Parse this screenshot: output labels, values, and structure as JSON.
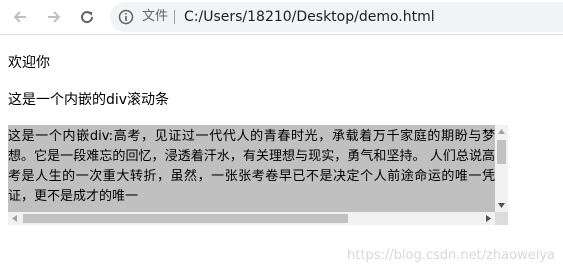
{
  "browser": {
    "security_label": "文件",
    "url": "C:/Users/18210/Desktop/demo.html",
    "icons": [
      "back-arrow-icon",
      "forward-arrow-icon",
      "reload-icon",
      "info-icon"
    ]
  },
  "page": {
    "greeting": "欢迎你",
    "subtitle": "这是一个内嵌的div滚动条",
    "scroll_text": "这是一个内嵌div:高考，见证过一代代人的青春时光，承载着万千家庭的期盼与梦想。它是一段难忘的回忆，浸透着汗水，有关理想与现实，勇气和坚持。 人们总说高考是人生的一次重大转折，虽然，一张张考卷早已不是决定个人前途命运的唯一凭证，更不是成才的唯一"
  },
  "watermark": "https://blog.csdn.net/zhaoweiya",
  "colors": {
    "scroll_box_background": "#c0c0c0",
    "omnibox_background": "#f1f3f4"
  }
}
